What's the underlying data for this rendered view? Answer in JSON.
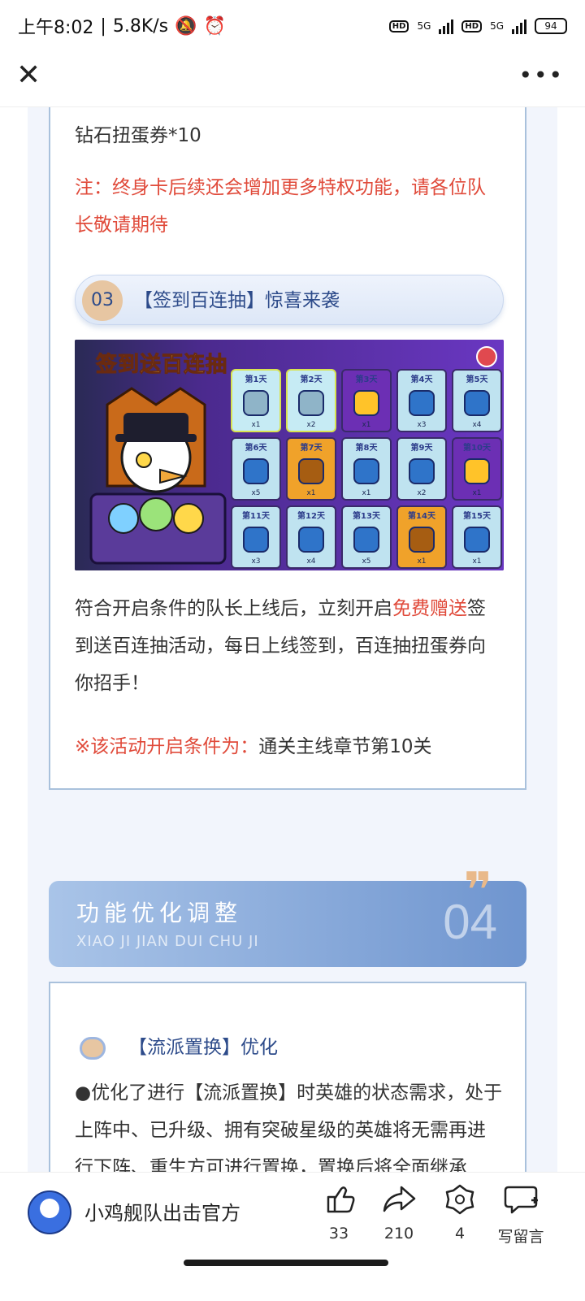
{
  "status": {
    "time": "上午8:02",
    "net_speed": "5.8K/s",
    "signal1": "5G",
    "signal2": "5G",
    "battery": "94"
  },
  "nav": {
    "close_icon": "close-icon",
    "more_icon": "more-icon"
  },
  "article": {
    "reward_line": "钻石扭蛋券*10",
    "note": "注：终身卡后续还会增加更多特权功能，请各位队长敬请期待",
    "section3": {
      "num": "03",
      "title": "【签到百连抽】惊喜来袭"
    },
    "banner": {
      "title": "签到送百连抽",
      "days": [
        {
          "day": "第1天",
          "qty": "x1",
          "state": "done"
        },
        {
          "day": "第2天",
          "qty": "x2",
          "state": "done"
        },
        {
          "day": "第3天",
          "qty": "x1",
          "state": "purple"
        },
        {
          "day": "第4天",
          "qty": "x3",
          "state": "normal"
        },
        {
          "day": "第5天",
          "qty": "x4",
          "state": "normal"
        },
        {
          "day": "第6天",
          "qty": "x5",
          "state": "normal"
        },
        {
          "day": "第7天",
          "qty": "x1",
          "state": "big"
        },
        {
          "day": "第8天",
          "qty": "x1",
          "state": "normal"
        },
        {
          "day": "第9天",
          "qty": "x2",
          "state": "normal"
        },
        {
          "day": "第10天",
          "qty": "x1",
          "state": "purple"
        },
        {
          "day": "第11天",
          "qty": "x3",
          "state": "normal"
        },
        {
          "day": "第12天",
          "qty": "x4",
          "state": "normal"
        },
        {
          "day": "第13天",
          "qty": "x5",
          "state": "normal"
        },
        {
          "day": "第14天",
          "qty": "x1",
          "state": "big"
        },
        {
          "day": "第15天",
          "qty": "x1",
          "state": "normal"
        }
      ]
    },
    "para_part1": "符合开启条件的队长上线后，立刻开启",
    "para_red": "免费赠送",
    "para_part2": "签到送百连抽活动，每日上线签到，百连抽扭蛋券向你招手！",
    "condition_label": "※该活动开启条件为：",
    "condition_value": "通关主线章节第10关",
    "section4": {
      "title": "功能优化调整",
      "subtitle": "XIAO JI JIAN DUI CHU JI",
      "num": "04"
    },
    "subsection_title": "【流派置换】优化",
    "subsection_body": "●优化了进行【流派置换】时英雄的状态需求，处于上阵中、已升级、拥有突破星级的英雄将无需再进行下阵、重生方可进行置换，置换后将全面继承"
  },
  "bottom": {
    "account_name": "小鸡舰队出击官方",
    "like_count": "33",
    "share_count": "210",
    "wow_count": "4",
    "comment_label": "写留言"
  }
}
